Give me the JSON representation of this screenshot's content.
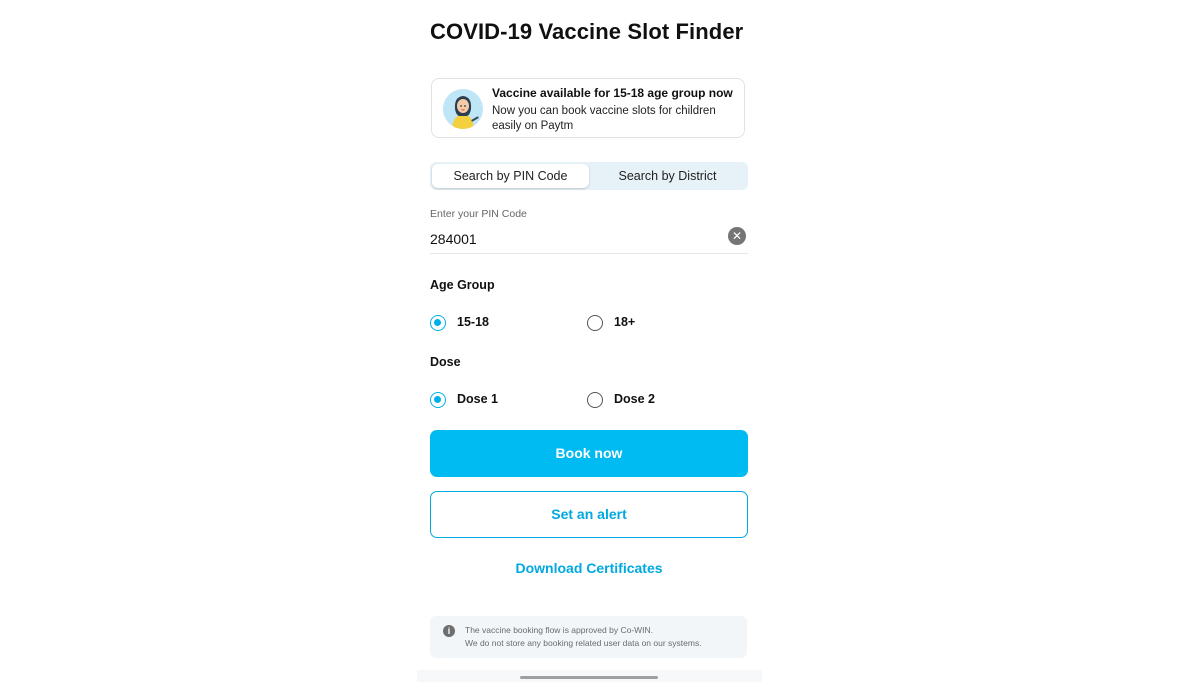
{
  "page": {
    "title": "COVID-19 Vaccine Slot Finder"
  },
  "banner": {
    "icon": "vaccine-girl-illustration",
    "title": "Vaccine available for 15-18 age group now",
    "text": "Now you can book vaccine slots for children easily on Paytm"
  },
  "search_mode": {
    "tabs": [
      {
        "label": "Search by PIN Code",
        "active": true
      },
      {
        "label": "Search by District",
        "active": false
      }
    ]
  },
  "pin": {
    "label": "Enter your PIN Code",
    "value": "284001",
    "clear_icon": "clear-icon"
  },
  "age_group": {
    "label": "Age Group",
    "options": [
      {
        "label": "15-18",
        "selected": true
      },
      {
        "label": "18+",
        "selected": false
      }
    ]
  },
  "dose": {
    "label": "Dose",
    "options": [
      {
        "label": "Dose 1",
        "selected": true
      },
      {
        "label": "Dose 2",
        "selected": false
      }
    ]
  },
  "actions": {
    "book_label": "Book now",
    "alert_label": "Set an alert",
    "download_label": "Download Certificates"
  },
  "info": {
    "icon": "info-icon",
    "line1": "The vaccine booking flow is approved by Co-WIN.",
    "line2": "We do not store any booking related user data on our systems."
  },
  "colors": {
    "accent": "#00baf2",
    "accent_text": "#00a9e0",
    "segment_bg": "#e6f1f8",
    "info_bg": "#f2f6f9"
  }
}
